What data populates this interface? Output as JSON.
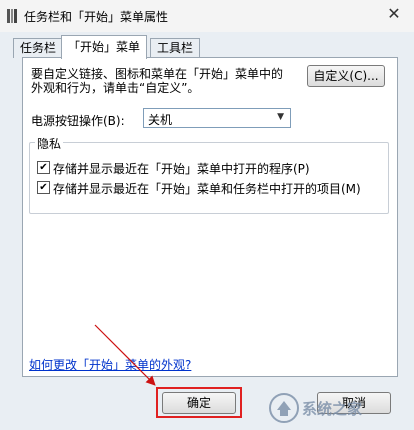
{
  "window": {
    "title": "任务栏和「开始」菜单属性",
    "close_glyph": "✕"
  },
  "tabs": [
    {
      "label": "任务栏"
    },
    {
      "label": "「开始」菜单"
    },
    {
      "label": "工具栏"
    }
  ],
  "start_menu": {
    "description_line1": "要自定义链接、图标和菜单在「开始」菜单中的",
    "description_line2": "外观和行为，请单击“自定义”。",
    "customize_label": "自定义(C)...",
    "power_label": "电源按钮操作(B):",
    "power_value": "关机",
    "privacy_group": "隐私",
    "privacy_options": [
      {
        "label": "存储并显示最近在「开始」菜单中打开的程序(P)",
        "checked": true
      },
      {
        "label": "存储并显示最近在「开始」菜单和任务栏中打开的项目(M)",
        "checked": true
      }
    ],
    "help_link": "如何更改「开始」菜单的外观?"
  },
  "buttons": {
    "ok": "确定",
    "cancel": "取消"
  },
  "annotation": {
    "highlight_color": "#e02020"
  },
  "watermark": {
    "text": "系统之家"
  }
}
